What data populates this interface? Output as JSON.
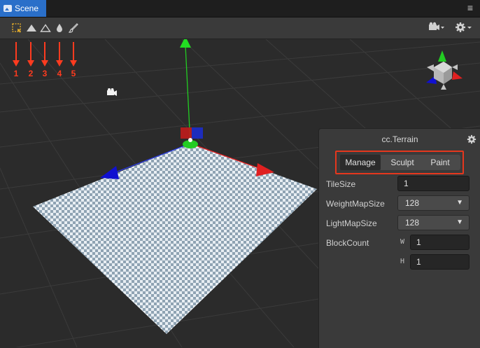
{
  "tab": {
    "title": "Scene"
  },
  "header": {
    "menu_icon": "≡"
  },
  "toolbar": {
    "tools": [
      {
        "name": "select-rect-icon",
        "glyph": "⬚"
      },
      {
        "name": "terrain-raise-icon",
        "glyph": "▲"
      },
      {
        "name": "terrain-lower-icon",
        "glyph": "△"
      },
      {
        "name": "drop-icon",
        "glyph": "●"
      },
      {
        "name": "brush-icon",
        "glyph": "✎"
      }
    ],
    "right": {
      "camera_icon": "camera-dropdown-icon",
      "gear_icon": "gear-dropdown-icon"
    }
  },
  "annotations": {
    "labels": [
      "1",
      "2",
      "3",
      "4",
      "5"
    ],
    "color": "#ff3b1f"
  },
  "inspector": {
    "title": "cc.Terrain",
    "tabs": [
      {
        "label": "Manage",
        "selected": true
      },
      {
        "label": "Sculpt",
        "selected": false
      },
      {
        "label": "Paint",
        "selected": false
      }
    ],
    "props": {
      "tile_size": {
        "label": "TileSize",
        "value": "1"
      },
      "weight_map_size": {
        "label": "WeightMapSize",
        "value": "128"
      },
      "light_map_size": {
        "label": "LightMapSize",
        "value": "128"
      },
      "block_count": {
        "label": "BlockCount",
        "w_label": "W",
        "w_value": "1",
        "h_label": "H",
        "h_value": "1"
      }
    }
  },
  "colors": {
    "tab_active": "#2a6fc9",
    "highlight": "#e5371d",
    "axis_y": "#22cc22",
    "axis_x": "#e02020",
    "axis_z": "#2020e0"
  }
}
